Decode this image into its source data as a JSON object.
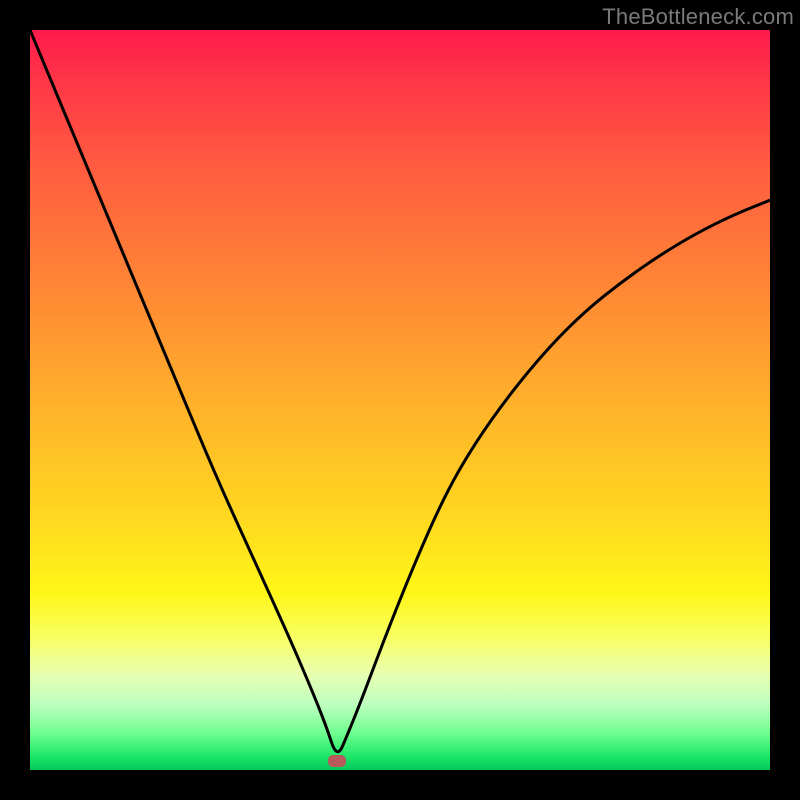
{
  "watermark": "TheBottleneck.com",
  "marker": {
    "cx_pct": 41.5,
    "cy_pct": 98.8
  },
  "colors": {
    "curve": "#000000",
    "marker": "#b85a5a",
    "frame": "#000000"
  },
  "chart_data": {
    "type": "line",
    "title": "",
    "xlabel": "",
    "ylabel": "",
    "xlim": [
      0,
      100
    ],
    "ylim": [
      0,
      100
    ],
    "grid": false,
    "legend": false,
    "annotations": [
      "TheBottleneck.com"
    ],
    "series": [
      {
        "name": "bottleneck-curve",
        "x": [
          0,
          5,
          10,
          15,
          20,
          25,
          30,
          35,
          38,
          40,
          41.5,
          43,
          45,
          48,
          52,
          56,
          60,
          65,
          70,
          75,
          80,
          85,
          90,
          95,
          100
        ],
        "y": [
          100,
          88,
          76,
          64,
          52,
          40,
          29,
          18,
          11,
          6,
          1.5,
          5,
          10,
          18,
          28,
          37,
          44,
          51,
          57,
          62,
          66,
          69.5,
          72.5,
          75,
          77
        ]
      }
    ],
    "background_gradient": {
      "direction": "top_to_bottom",
      "stops": [
        {
          "pct": 0,
          "color": "#ff1a4d"
        },
        {
          "pct": 50,
          "color": "#ffba28"
        },
        {
          "pct": 80,
          "color": "#f8ff60"
        },
        {
          "pct": 100,
          "color": "#00c85a"
        }
      ]
    },
    "optimal_point": {
      "x": 41.5,
      "y": 1.5
    }
  }
}
